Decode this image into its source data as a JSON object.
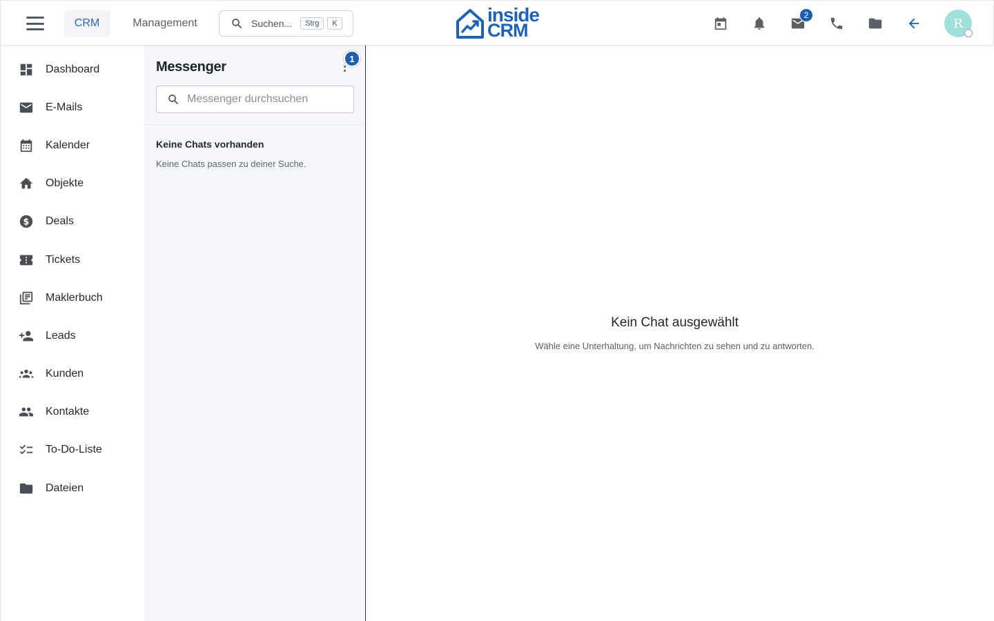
{
  "topbar": {
    "menu_icon": "hamburger-menu-icon",
    "tabs": [
      {
        "label": "CRM",
        "active": true
      },
      {
        "label": "Management",
        "active": false
      }
    ],
    "search": {
      "placeholder": "Suchen...",
      "shortcut_1": "Strg",
      "shortcut_2": "K"
    },
    "logo": {
      "line1": "inside",
      "line2": "CRM"
    },
    "icons": [
      "calendar-icon",
      "bell-icon",
      "mail-icon",
      "phone-icon",
      "folder-icon",
      "arrow-left-icon"
    ],
    "mail_badge": "2",
    "avatar_initial": "R",
    "accent_color": "#1d5eb0"
  },
  "sidebar": {
    "items": [
      {
        "label": "Dashboard",
        "icon": "dashboard-icon"
      },
      {
        "label": "E-Mails",
        "icon": "mail-icon"
      },
      {
        "label": "Kalender",
        "icon": "calendar-icon"
      },
      {
        "label": "Objekte",
        "icon": "house-icon"
      },
      {
        "label": "Deals",
        "icon": "dollar-circle-icon"
      },
      {
        "label": "Tickets",
        "icon": "ticket-icon"
      },
      {
        "label": "Maklerbuch",
        "icon": "library-icon"
      },
      {
        "label": "Leads",
        "icon": "person-add-icon"
      },
      {
        "label": "Kunden",
        "icon": "groups-icon"
      },
      {
        "label": "Kontakte",
        "icon": "people-icon"
      },
      {
        "label": "To-Do-Liste",
        "icon": "checklist-icon"
      },
      {
        "label": "Dateien",
        "icon": "folder-icon"
      }
    ]
  },
  "messenger": {
    "title": "Messenger",
    "badge": "1",
    "search_placeholder": "Messenger durchsuchen",
    "empty_title": "Keine Chats vorhanden",
    "empty_sub": "Keine Chats passen zu deiner Suche."
  },
  "main": {
    "title": "Kein Chat ausgewählt",
    "subtitle": "Wähle eine Unterhaltung, um Nachrichten zu sehen und zu antworten."
  }
}
